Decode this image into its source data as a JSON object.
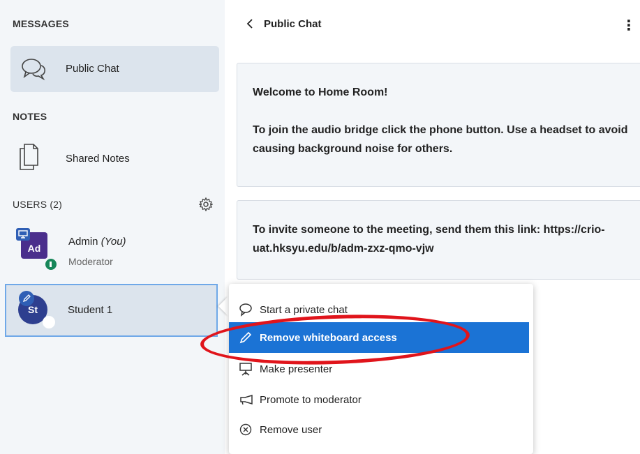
{
  "sidebar": {
    "messages_title": "MESSAGES",
    "public_chat_label": "Public Chat",
    "notes_title": "NOTES",
    "shared_notes_label": "Shared Notes",
    "users_title": "USERS (2)",
    "users": [
      {
        "initials": "Ad",
        "name": "Admin",
        "you_label": "(You)",
        "role": "Moderator",
        "color": "#4a2e8c"
      },
      {
        "initials": "St",
        "name": "Student 1",
        "color": "#2e3f8f"
      }
    ]
  },
  "chat": {
    "header": "Public Chat",
    "message1_title_prefix": "Welcome to ",
    "message1_title_bold": "Home Room!",
    "message1_body": "To join the audio bridge click the phone button. Use a headset to avoid causing background noise for others.",
    "message2_body": "To invite someone to the meeting, send them this link: https://crio-uat.hksyu.edu/b/adm-zxz-qmo-vjw"
  },
  "context_menu": {
    "items": [
      {
        "label": "Start a private chat",
        "icon": "chat-bubble-icon"
      },
      {
        "label": "Remove whiteboard access",
        "icon": "pencil-icon"
      },
      {
        "label": "Make presenter",
        "icon": "presentation-icon"
      },
      {
        "label": "Promote to moderator",
        "icon": "megaphone-icon"
      },
      {
        "label": "Remove user",
        "icon": "circle-x-icon"
      }
    ]
  },
  "colors": {
    "sidebar_bg": "#f3f6f9",
    "highlight": "#1b73d5",
    "annotation_red": "#e0141b"
  }
}
